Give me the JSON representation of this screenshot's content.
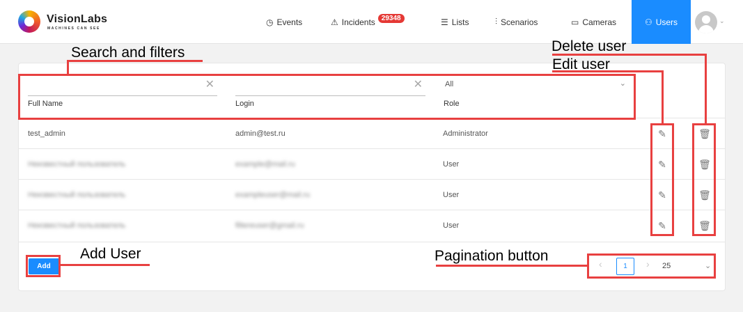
{
  "header": {
    "brand": "VisionLabs",
    "brand_sub": "MACHINES CAN SEE",
    "nav": [
      {
        "label": "Events",
        "icon": "clock-icon"
      },
      {
        "label": "Incidents",
        "icon": "warning-icon",
        "badge": "29348"
      },
      {
        "label": "Lists",
        "icon": "list-icon"
      },
      {
        "label": "Scenarios",
        "icon": "sliders-icon"
      },
      {
        "label": "Cameras",
        "icon": "camera-icon"
      },
      {
        "label": "Users",
        "icon": "users-icon",
        "active": true
      }
    ]
  },
  "filters": {
    "full_name_label": "Full Name",
    "login_label": "Login",
    "role_label": "Role",
    "role_value": "All"
  },
  "users": [
    {
      "name": "test_admin",
      "login": "admin@test.ru",
      "role": "Administrator",
      "blurred": false
    },
    {
      "name": "Неизвестный пользователь",
      "login": "example@mail.ru",
      "role": "User",
      "blurred": true
    },
    {
      "name": "Неизвестный пользователь",
      "login": "exampleuser@mail.ru",
      "role": "User",
      "blurred": true
    },
    {
      "name": "Неизвестный пользователь",
      "login": "filtereuser@gmail.ru",
      "role": "User",
      "blurred": true
    }
  ],
  "add_label": "Add",
  "pagination": {
    "page": "1",
    "page_size": "25"
  },
  "annotations": {
    "search": "Search and filters",
    "delete": "Delete user",
    "edit": "Edit user",
    "add": "Add User",
    "pagination": "Pagination button"
  },
  "colors": {
    "accent": "#1a8cff",
    "badge": "#e53935",
    "annotation": "#e84040"
  }
}
